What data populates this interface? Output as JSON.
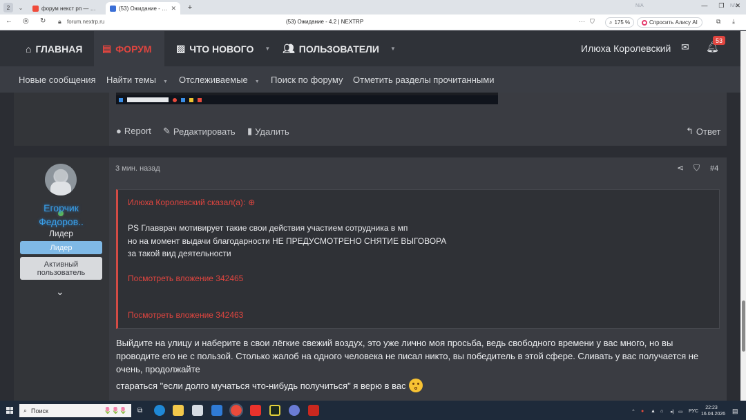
{
  "browser": {
    "tab_count": "2",
    "tabs": [
      {
        "title": "форум некст рп — Яндекс",
        "active": false
      },
      {
        "title": "(53) Ожидание - 4.2 | NEXTRP",
        "active": true
      }
    ],
    "new_tab_label": "+",
    "address": "forum.nextrp.ru",
    "page_title": "(53) Ожидание - 4.2 | NEXTRP",
    "zoom": "175 %",
    "alice_label": "Спросить Алису AI",
    "ghost_text_1": "N/A",
    "ghost_text_2": "N/A"
  },
  "site": {
    "nav": [
      {
        "label": "ГЛАВНАЯ",
        "icon": "home-icon"
      },
      {
        "label": "ФОРУМ",
        "icon": "forum-icon",
        "active": true
      },
      {
        "label": "ЧТО НОВОГО",
        "icon": "whats-new-icon"
      },
      {
        "label": "ПОЛЬЗОВАТЕЛИ",
        "icon": "users-icon"
      }
    ],
    "username": "Илюха Королевский",
    "alerts_count": "53",
    "subnav": [
      "Новые сообщения",
      "Найти темы",
      "Отслеживаемые",
      "Поиск по форуму",
      "Отметить разделы прочитанными"
    ]
  },
  "prev_post": {
    "actions": {
      "report": "Report",
      "edit": "Редактировать",
      "delete": "Удалить",
      "reply": "Ответ"
    }
  },
  "post": {
    "time": "3 мин. назад",
    "number": "#4",
    "author": {
      "name": "Егорчик Федоров..",
      "title": "Лидер",
      "badge1": "Лидер",
      "badge2": "Активный пользователь"
    },
    "quote": {
      "header": "Илюха Королевский сказал(а):",
      "lines": [
        "PS Главврач мотивирует такие свои действия участием сотрудника в мп",
        "но на момент выдачи благодарности НЕ ПРЕДУСМОТРЕНО СНЯТИЕ ВЫГОВОРА",
        "за такой вид деятельности"
      ],
      "attachment1": "Посмотреть вложение 342465",
      "attachment2": "Посмотреть вложение 342463"
    },
    "body": [
      "Выйдите на улицу и наберите в свои лёгкие свежий воздух, это уже лично моя просьба, ведь свободного времени у вас много, но вы проводите его не с пользой. Столько жалоб на одного человека не писал никто, вы победитель в этой сфере. Сливать у вас получается не очень, продолжайте",
      "стараться \"если долго мучаться что-нибудь получиться\" я верю в вас"
    ]
  },
  "taskbar": {
    "search_placeholder": "Поиск",
    "lang": "РУС",
    "time": "22:23",
    "date": "16.04.2026"
  },
  "colors": {
    "accent": "#e0453f",
    "badge_blue": "#7fb9e6",
    "link_blue": "#3aa0e8"
  }
}
